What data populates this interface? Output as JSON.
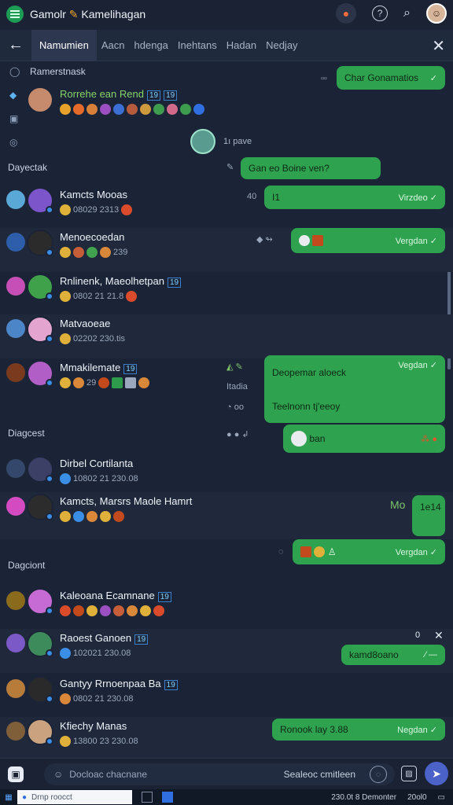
{
  "app": {
    "title_prefix": "Gamolr",
    "title_brand": "Kamelihagan"
  },
  "tabs": {
    "back_icon": "back-arrow-icon",
    "items": [
      {
        "label": "Namumien",
        "active": true
      },
      {
        "label": "Aacn"
      },
      {
        "label": "hdenga"
      },
      {
        "label": "Inehtans"
      },
      {
        "label": "Hadan"
      },
      {
        "label": "Nedjay"
      }
    ]
  },
  "header_group": {
    "title": "Ramerstnask",
    "name": "Rorrehe ean Rend",
    "tag1": "19",
    "tag2": "19",
    "center_label": "1ı pave"
  },
  "sections": [
    "Dayectak",
    "Diagcest",
    "Dagciont"
  ],
  "rows": [
    {
      "name": "Kamcts Mooas",
      "meta": "08029 2313",
      "bubble": "Virzdeo",
      "side": "40",
      "pic_s": "#5aa8d6",
      "pic_l": "#7b55c9"
    },
    {
      "name": "Menoecoedan",
      "meta": "239",
      "bubble": "Vergdan",
      "pic_s": "#2e5ea9",
      "pic_l": "#2b2b2b"
    },
    {
      "name": "Rnlinenk, Maeolhetpan",
      "tag": "19",
      "meta": "0802 21 21.8",
      "pic_s": "#c54fb7",
      "pic_l": "#3fa14a"
    },
    {
      "name": "Matvaoeae",
      "meta": "02202 230.tis",
      "pic_s": "#4c86c8",
      "pic_l": "#e3a4d0"
    },
    {
      "name": "Mmakilemate",
      "tag": "19",
      "meta": "29",
      "bubble_top": "Deopemar aloeck",
      "bubble_bottom": "Teelnonn tj'eeoy",
      "bubble_check": "Vegdan",
      "pic_s": "#7a3a1e",
      "pic_l": "#b15fc7"
    },
    {
      "name": "Dirbel Cortilanta",
      "meta": "10802 21 230.08",
      "bubble": "Kan",
      "pic_s": "#34486b",
      "pic_l": "#3c3f66"
    },
    {
      "name": "Kamcts, Marsrs Maole Hamrt",
      "meta": "",
      "bubble": "1e14",
      "side": "Mo",
      "pic_s": "#d44bc1",
      "pic_l": "#2c2c2c"
    },
    {
      "name": "Kaleoana Ecamnane",
      "tag": "19",
      "meta": "",
      "bubble": "Vergdan",
      "pic_s": "#8a6a1d",
      "pic_l": "#c66bd4"
    },
    {
      "name": "Raoest Ganoen",
      "tag": "19",
      "meta": "102021 230.08",
      "bubble": "kamd8oano",
      "pic_s": "#7b59c7",
      "pic_l": "#3d8a5a"
    },
    {
      "name": "Gantyy Rrnoenpaa Ba",
      "tag": "19",
      "meta": "0802 21 230.08",
      "pic_s": "#b77c3a",
      "pic_l": "#2a2a2a"
    },
    {
      "name": "Kfiechy Manas",
      "meta": "13800 23 230.08",
      "bubble": "Ronook lay 3.88",
      "bubble_check": "Negdan",
      "pic_s": "#7f5f3a",
      "pic_l": "#caa27f"
    }
  ],
  "bubbles": {
    "top": "Char Gonamatios",
    "question": "Gan eo Boine ven?",
    "small_1": "I1",
    "ban": "ban"
  },
  "composer": {
    "placeholder": "Docloac chacnane",
    "right_hint": "Sealeoc cmitleen"
  },
  "taskbar": {
    "search": "Drnp roocct",
    "right_1": "230.0t 8 Demonter",
    "right_2": "20ol0"
  }
}
